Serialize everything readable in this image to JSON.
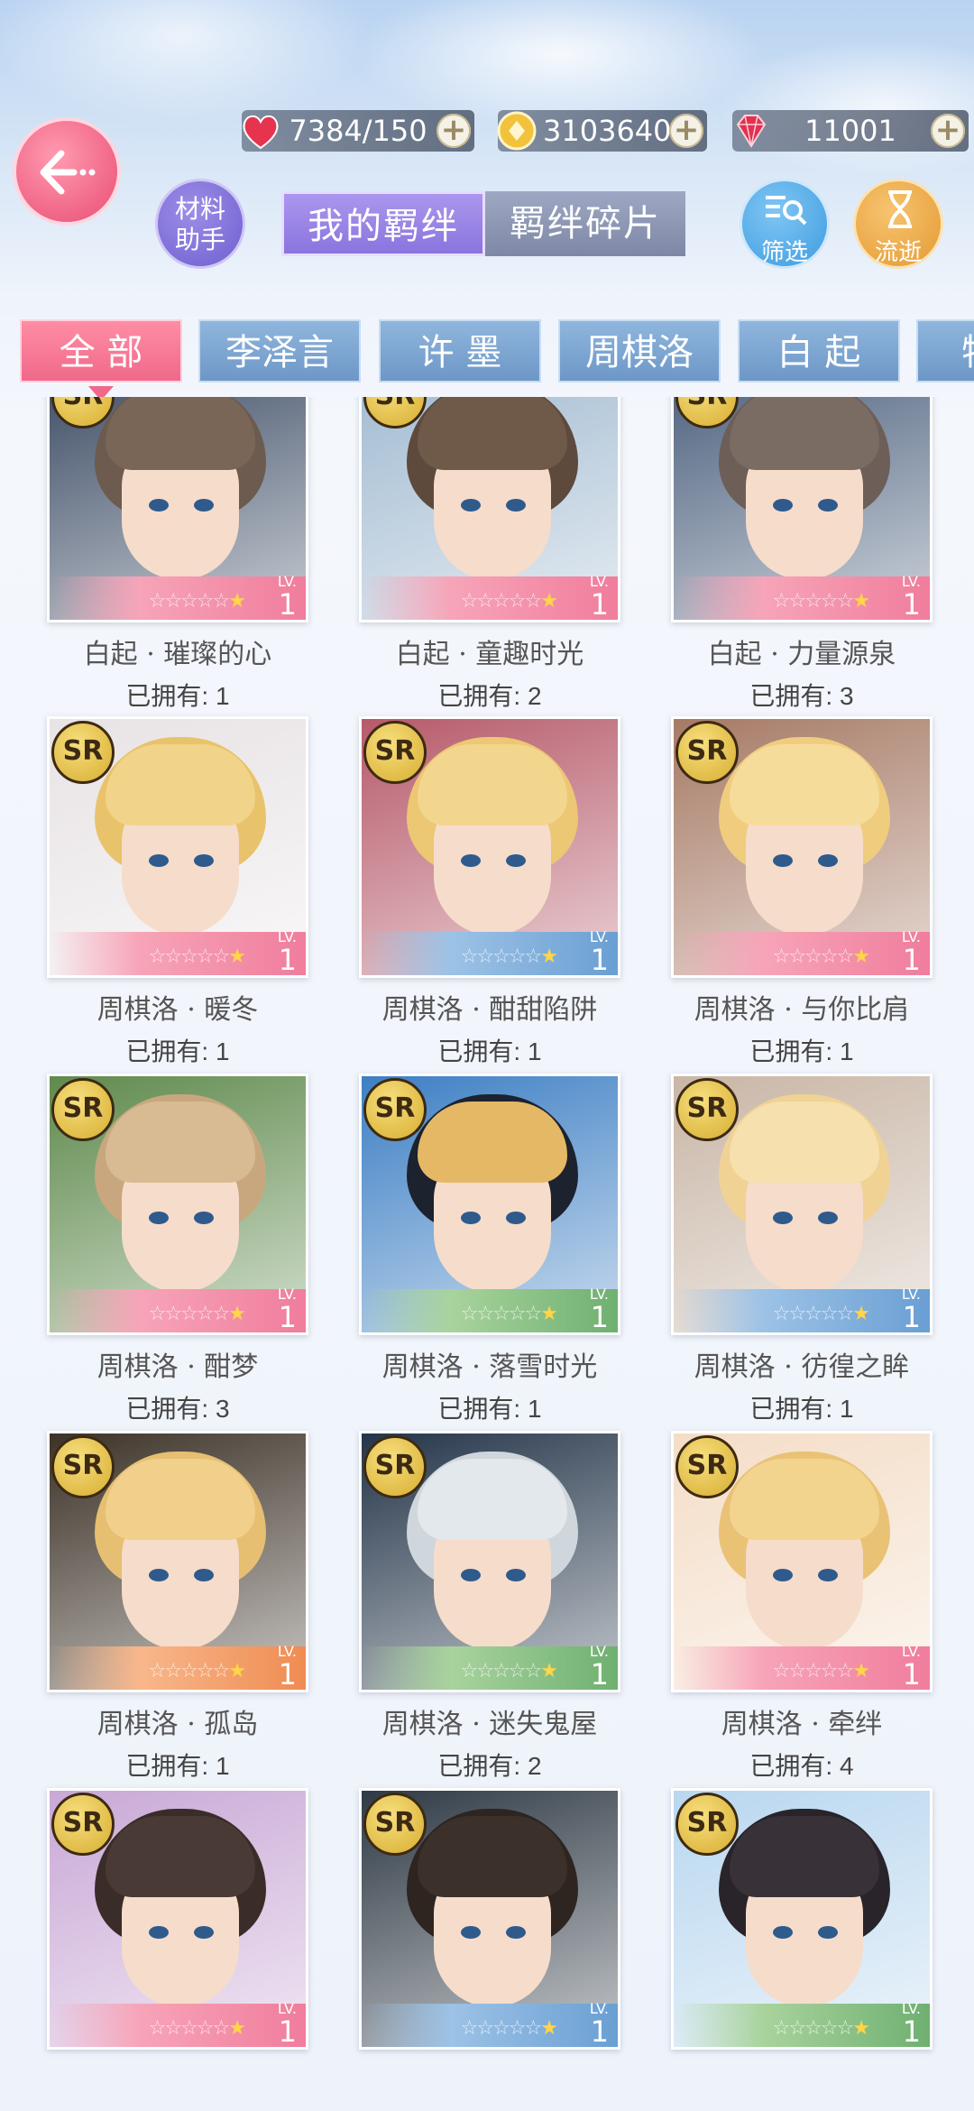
{
  "resources": {
    "stamina": "7384/150",
    "gold": "3103640",
    "diamond": "11001",
    "plus": "+"
  },
  "buttons": {
    "material_line1": "材料",
    "material_line2": "助手",
    "filter": "筛选",
    "lapse": "流逝"
  },
  "segments": {
    "my_bonds": "我的羁绊",
    "bond_fragments": "羁绊碎片"
  },
  "tabs": [
    "全 部",
    "李泽言",
    "许 墨",
    "周棋洛",
    "白 起",
    "特别"
  ],
  "cards": [
    {
      "name": "白起 · 璀璨的心",
      "owned": "已拥有: 1",
      "lv_label": "LV.",
      "lv": "1",
      "badge": "SR",
      "frame": "pink"
    },
    {
      "name": "白起 · 童趣时光",
      "owned": "已拥有: 2",
      "lv_label": "LV.",
      "lv": "1",
      "badge": "SR",
      "frame": "pink"
    },
    {
      "name": "白起 · 力量源泉",
      "owned": "已拥有: 3",
      "lv_label": "LV.",
      "lv": "1",
      "badge": "SR",
      "frame": "pink"
    },
    {
      "name": "周棋洛 · 暖冬",
      "owned": "已拥有: 1",
      "lv_label": "LV.",
      "lv": "1",
      "badge": "SR",
      "frame": "pink"
    },
    {
      "name": "周棋洛 · 酣甜陷阱",
      "owned": "已拥有: 1",
      "lv_label": "LV.",
      "lv": "1",
      "badge": "SR",
      "frame": "blue"
    },
    {
      "name": "周棋洛 · 与你比肩",
      "owned": "已拥有: 1",
      "lv_label": "LV.",
      "lv": "1",
      "badge": "SR",
      "frame": "pink"
    },
    {
      "name": "周棋洛 · 酣梦",
      "owned": "已拥有: 3",
      "lv_label": "LV.",
      "lv": "1",
      "badge": "SR",
      "frame": "pink"
    },
    {
      "name": "周棋洛 · 落雪时光",
      "owned": "已拥有: 1",
      "lv_label": "LV.",
      "lv": "1",
      "badge": "SR",
      "frame": "green"
    },
    {
      "name": "周棋洛 · 彷徨之眸",
      "owned": "已拥有: 1",
      "lv_label": "LV.",
      "lv": "1",
      "badge": "SR",
      "frame": "blue"
    },
    {
      "name": "周棋洛 · 孤岛",
      "owned": "已拥有: 1",
      "lv_label": "LV.",
      "lv": "1",
      "badge": "SR",
      "frame": "orange"
    },
    {
      "name": "周棋洛 · 迷失鬼屋",
      "owned": "已拥有: 2",
      "lv_label": "LV.",
      "lv": "1",
      "badge": "SR",
      "frame": "green"
    },
    {
      "name": "周棋洛 · 牵绊",
      "owned": "已拥有: 4",
      "lv_label": "LV.",
      "lv": "1",
      "badge": "SR",
      "frame": "pink"
    },
    {
      "name": "",
      "owned": "",
      "lv_label": "LV.",
      "lv": "1",
      "badge": "SR",
      "frame": "pink"
    },
    {
      "name": "",
      "owned": "",
      "lv_label": "LV.",
      "lv": "1",
      "badge": "SR",
      "frame": "blue"
    },
    {
      "name": "",
      "owned": "",
      "lv_label": "LV.",
      "lv": "1",
      "badge": "SR",
      "frame": "green"
    }
  ],
  "colors": {
    "accent_pink": "#f0698a",
    "tab_blue": "#6d97c7",
    "segment_purple": "#8a74de"
  }
}
